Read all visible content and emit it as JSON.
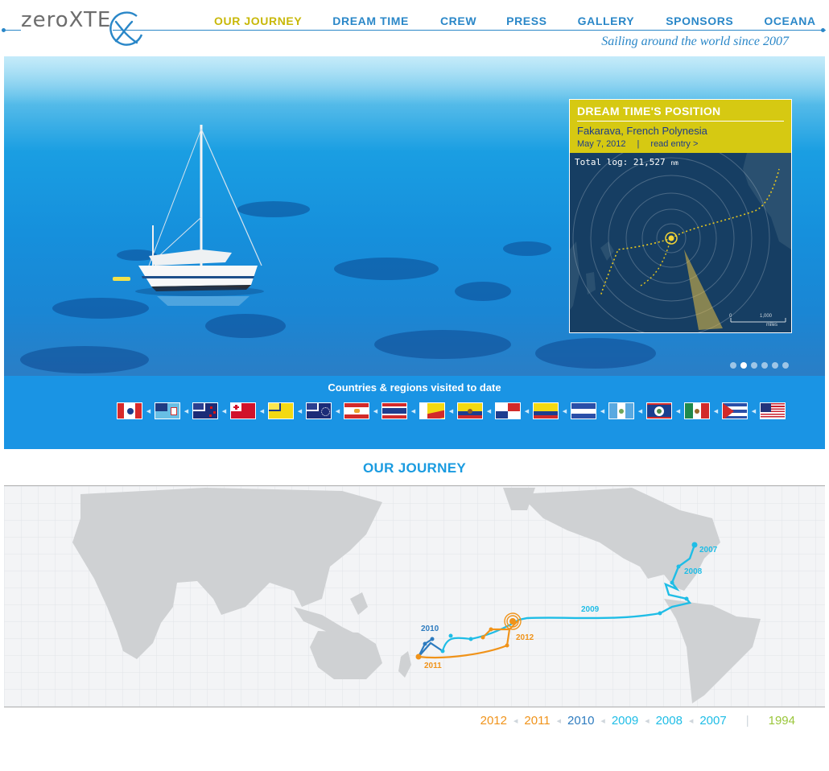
{
  "brand": {
    "logo_text": "zeroXTE",
    "tagline": "Sailing around the world since 2007"
  },
  "nav": {
    "items": [
      {
        "label": "OUR JOURNEY",
        "active": true,
        "color": "#c8b809"
      },
      {
        "label": "DREAM TIME",
        "active": false,
        "color": "#2a87c8"
      },
      {
        "label": "CREW",
        "active": false,
        "color": "#2a87c8"
      },
      {
        "label": "PRESS",
        "active": false,
        "color": "#2a87c8"
      },
      {
        "label": "GALLERY",
        "active": false,
        "color": "#2a87c8"
      },
      {
        "label": "SPONSORS",
        "active": false,
        "color": "#2a87c8"
      },
      {
        "label": "OCEANA",
        "active": false,
        "color": "#2a87c8"
      }
    ]
  },
  "position": {
    "title": "DREAM TIME'S POSITION",
    "location": "Fakarava, French Polynesia",
    "date": "May 7, 2012",
    "separator": "|",
    "read_entry": "read entry >",
    "log_label": "Total log:",
    "log_value": "21,527",
    "log_unit": "nm",
    "scale_zero": "0",
    "scale_value": "1,000",
    "scale_unit": "miles"
  },
  "hero": {
    "slide_count": 6,
    "active_slide": 2
  },
  "countries": {
    "title": "Countries & regions visited to date",
    "flags": [
      "niue-like",
      "fiji",
      "new-zealand",
      "tonga",
      "niue",
      "cook-islands",
      "french-polynesia",
      "marquesas",
      "galapagos",
      "ecuador",
      "panama",
      "colombia",
      "honduras",
      "guatemala",
      "belize",
      "mexico",
      "cuba",
      "usa"
    ]
  },
  "journey": {
    "title": "OUR JOURNEY",
    "route_labels": [
      {
        "label": "2007",
        "color": "#1fbde6"
      },
      {
        "label": "2008",
        "color": "#1fbde6"
      },
      {
        "label": "2009",
        "color": "#1fbde6"
      },
      {
        "label": "2010",
        "color": "#2d7bbf"
      },
      {
        "label": "2011",
        "color": "#f0931a"
      },
      {
        "label": "2012",
        "color": "#f0931a"
      }
    ]
  },
  "years": [
    {
      "label": "2012",
      "color": "#f0931a"
    },
    {
      "label": "2011",
      "color": "#f0931a"
    },
    {
      "label": "2010",
      "color": "#2d7bbf"
    },
    {
      "label": "2009",
      "color": "#1fbde6"
    },
    {
      "label": "2008",
      "color": "#1fbde6"
    },
    {
      "label": "2007",
      "color": "#1fbde6"
    },
    {
      "label": "1994",
      "color": "#9ac63a"
    }
  ],
  "years_separator": "|"
}
